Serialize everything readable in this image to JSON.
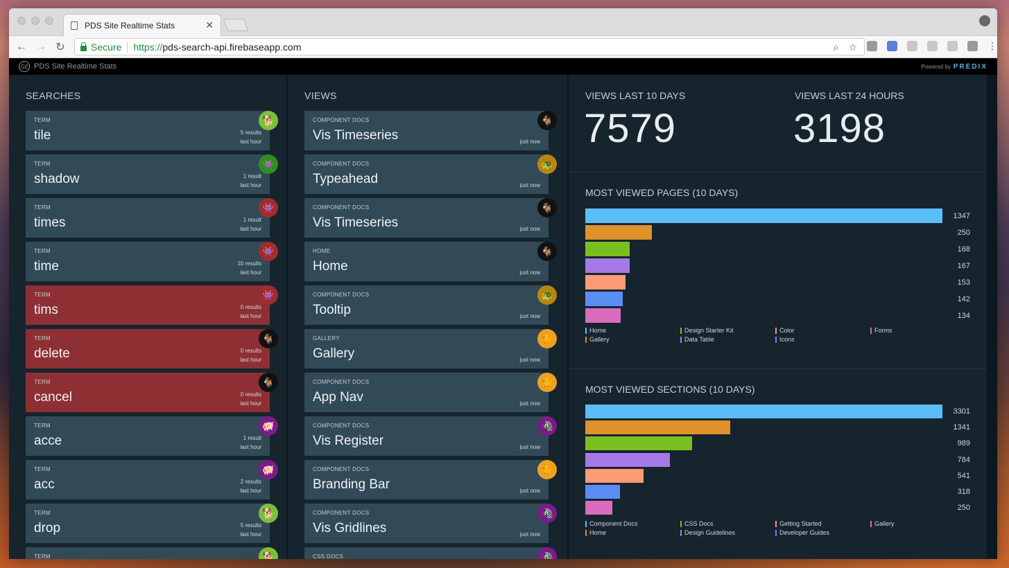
{
  "browser": {
    "tab_title": "PDS Site Realtime Stats",
    "secure_label": "Secure",
    "url_scheme": "https://",
    "url_host": "pds-search-api.firebaseapp.com"
  },
  "app": {
    "title": "PDS Site Realtime Stats",
    "logo_text": "GE",
    "powered_label": "Powered by",
    "powered_brand": "PREDIX"
  },
  "searches": {
    "heading": "SEARCHES",
    "items": [
      {
        "cat": "TERM",
        "name": "tile",
        "count": "5 results",
        "time": "last hour",
        "status": "ok",
        "avatar_color": "#7ac13a",
        "avatar_icon": "dog-icon"
      },
      {
        "cat": "TERM",
        "name": "shadow",
        "count": "1 result",
        "time": "last hour",
        "status": "ok",
        "avatar_color": "#2c8f1e",
        "avatar_icon": "alien-icon"
      },
      {
        "cat": "TERM",
        "name": "times",
        "count": "1 result",
        "time": "last hour",
        "status": "ok",
        "avatar_color": "#a22b2b",
        "avatar_icon": "alien-icon"
      },
      {
        "cat": "TERM",
        "name": "time",
        "count": "10 results",
        "time": "last hour",
        "status": "ok",
        "avatar_color": "#a22b2b",
        "avatar_icon": "alien-icon"
      },
      {
        "cat": "TERM",
        "name": "tims",
        "count": "0 results",
        "time": "last hour",
        "status": "fail",
        "avatar_color": "#a22b2b",
        "avatar_icon": "alien-icon"
      },
      {
        "cat": "TERM",
        "name": "delete",
        "count": "0 results",
        "time": "last hour",
        "status": "fail",
        "avatar_color": "#111111",
        "avatar_icon": "ram-icon"
      },
      {
        "cat": "TERM",
        "name": "cancel",
        "count": "0 results",
        "time": "last hour",
        "status": "fail",
        "avatar_color": "#111111",
        "avatar_icon": "ram-icon"
      },
      {
        "cat": "TERM",
        "name": "acce",
        "count": "1 result",
        "time": "last hour",
        "status": "ok",
        "avatar_color": "#7d1a8c",
        "avatar_icon": "pig-icon"
      },
      {
        "cat": "TERM",
        "name": "acc",
        "count": "2 results",
        "time": "last hour",
        "status": "ok",
        "avatar_color": "#7d1a8c",
        "avatar_icon": "pig-icon"
      },
      {
        "cat": "TERM",
        "name": "drop",
        "count": "5 results",
        "time": "last hour",
        "status": "ok",
        "avatar_color": "#7ac13a",
        "avatar_icon": "dog-icon"
      },
      {
        "cat": "TERM",
        "name": "",
        "count": "",
        "time": "",
        "status": "ok",
        "avatar_color": "#7ac13a",
        "avatar_icon": "dog-icon"
      }
    ]
  },
  "views": {
    "heading": "VIEWS",
    "items": [
      {
        "cat": "COMPONENT DOCS",
        "name": "Vis Timeseries",
        "time": "just now",
        "avatar_color": "#111111",
        "avatar_icon": "ram-icon"
      },
      {
        "cat": "COMPONENT DOCS",
        "name": "Typeahead",
        "time": "just now",
        "avatar_color": "#b8860b",
        "avatar_icon": "turtle-icon"
      },
      {
        "cat": "COMPONENT DOCS",
        "name": "Vis Timeseries",
        "time": "just now",
        "avatar_color": "#111111",
        "avatar_icon": "ram-icon"
      },
      {
        "cat": "HOME",
        "name": "Home",
        "time": "just now",
        "avatar_color": "#111111",
        "avatar_icon": "ram-icon"
      },
      {
        "cat": "COMPONENT DOCS",
        "name": "Tooltip",
        "time": "just now",
        "avatar_color": "#b8860b",
        "avatar_icon": "turtle-icon"
      },
      {
        "cat": "GALLERY",
        "name": "Gallery",
        "time": "just now",
        "avatar_color": "#f0a020",
        "avatar_icon": "cat-icon"
      },
      {
        "cat": "COMPONENT DOCS",
        "name": "App Nav",
        "time": "just now",
        "avatar_color": "#f0a020",
        "avatar_icon": "cat-icon"
      },
      {
        "cat": "COMPONENT DOCS",
        "name": "Vis Register",
        "time": "just now",
        "avatar_color": "#7d1a8c",
        "avatar_icon": "zebra-icon"
      },
      {
        "cat": "COMPONENT DOCS",
        "name": "Branding Bar",
        "time": "just now",
        "avatar_color": "#f0a020",
        "avatar_icon": "cat-icon"
      },
      {
        "cat": "COMPONENT DOCS",
        "name": "Vis Gridlines",
        "time": "just now",
        "avatar_color": "#7d1a8c",
        "avatar_icon": "zebra-icon"
      },
      {
        "cat": "CSS DOCS",
        "name": "",
        "time": "",
        "avatar_color": "#7d1a8c",
        "avatar_icon": "zebra-icon"
      }
    ]
  },
  "stats": {
    "views_10_label": "VIEWS LAST 10 DAYS",
    "views_10_value": "7579",
    "views_24_label": "VIEWS LAST 24 HOURS",
    "views_24_value": "3198"
  },
  "chart_data": [
    {
      "type": "bar",
      "orientation": "horizontal",
      "title": "MOST VIEWED PAGES (10 DAYS)",
      "categories": [
        "Home",
        "Gallery",
        "Design Starter Kit",
        "Data Table",
        "Color",
        "Icons",
        "Forms"
      ],
      "values": [
        1347,
        250,
        168,
        167,
        153,
        142,
        134
      ],
      "colors": [
        "#5bbdf5",
        "#e0912a",
        "#7bbf1e",
        "#a57ae8",
        "#fb9a74",
        "#5b8ef5",
        "#da6cc0"
      ],
      "legend": [
        "Home",
        "Design Starter Kit",
        "Color",
        "Forms",
        "Gallery",
        "Data Table",
        "Icons"
      ],
      "legend_colors": [
        "#5bbdf5",
        "#7bbf1e",
        "#fb9a74",
        "#da6cc0",
        "#e0912a",
        "#a57ae8",
        "#5b8ef5"
      ]
    },
    {
      "type": "bar",
      "orientation": "horizontal",
      "title": "MOST VIEWED SECTIONS (10 DAYS)",
      "categories": [
        "Component Docs",
        "Home",
        "CSS Docs",
        "Design Guidelines",
        "Getting Started",
        "Developer Guides",
        "Gallery"
      ],
      "values": [
        3301,
        1341,
        989,
        784,
        541,
        318,
        250
      ],
      "colors": [
        "#5bbdf5",
        "#e0912a",
        "#7bbf1e",
        "#a57ae8",
        "#fb9a74",
        "#5b8ef5",
        "#da6cc0"
      ],
      "legend": [
        "Component Docs",
        "CSS Docs",
        "Getting Started",
        "Gallery",
        "Home",
        "Design Guidelines",
        "Developer Guides"
      ],
      "legend_colors": [
        "#5bbdf5",
        "#7bbf1e",
        "#fb9a74",
        "#da6cc0",
        "#e0912a",
        "#a57ae8",
        "#5b8ef5"
      ]
    }
  ]
}
